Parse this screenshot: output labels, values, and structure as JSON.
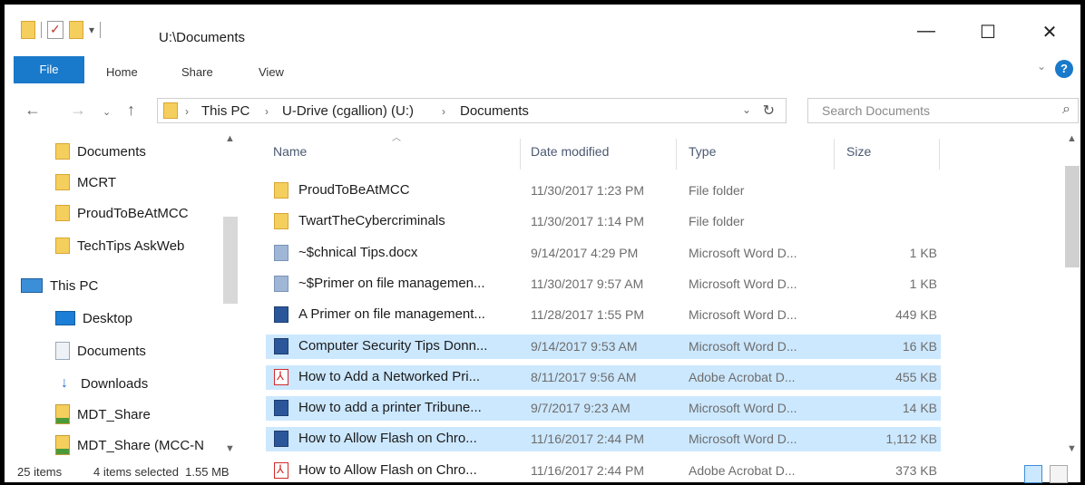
{
  "window": {
    "title": "U:\\Documents"
  },
  "window_controls": {
    "minimize": "—",
    "maximize": "☐",
    "close": "✕"
  },
  "ribbon": {
    "tabs": [
      "File",
      "Home",
      "Share",
      "View"
    ]
  },
  "address": {
    "crumbs": [
      "This PC",
      "U-Drive (cgallion) (U:)",
      "Documents"
    ],
    "search_placeholder": "Search Documents"
  },
  "nav_pane": {
    "items": [
      {
        "label": "Documents",
        "icon": "folder-icon"
      },
      {
        "label": "MCRT",
        "icon": "folder-icon"
      },
      {
        "label": "ProudToBeAtMCC",
        "icon": "folder-icon"
      },
      {
        "label": "TechTips AskWeb",
        "icon": "folder-icon"
      },
      {
        "label": "This PC",
        "icon": "pc-icon"
      },
      {
        "label": "Desktop",
        "icon": "desktop-icon"
      },
      {
        "label": "Documents",
        "icon": "documents-icon"
      },
      {
        "label": "Downloads",
        "icon": "downloads-icon"
      },
      {
        "label": "MDT_Share",
        "icon": "network-share-icon"
      },
      {
        "label": "MDT_Share (MCC-N",
        "icon": "network-share-icon"
      }
    ]
  },
  "columns": {
    "name": "Name",
    "date": "Date modified",
    "type": "Type",
    "size": "Size"
  },
  "files": [
    {
      "name": "ProudToBeAtMCC",
      "date": "11/30/2017 1:23 PM",
      "type": "File folder",
      "size": "",
      "icon": "folder",
      "selected": false
    },
    {
      "name": "TwartTheCybercriminals",
      "date": "11/30/2017 1:14 PM",
      "type": "File folder",
      "size": "",
      "icon": "folder",
      "selected": false
    },
    {
      "name": "~$chnical Tips.docx",
      "date": "9/14/2017 4:29 PM",
      "type": "Microsoft Word D...",
      "size": "1 KB",
      "icon": "wordtemp",
      "selected": false
    },
    {
      "name": "~$Primer on file managemen...",
      "date": "11/30/2017 9:57 AM",
      "type": "Microsoft Word D...",
      "size": "1 KB",
      "icon": "wordtemp",
      "selected": false
    },
    {
      "name": "A Primer on file management...",
      "date": "11/28/2017 1:55 PM",
      "type": "Microsoft Word D...",
      "size": "449 KB",
      "icon": "word",
      "selected": false
    },
    {
      "name": "Computer Security Tips Donn...",
      "date": "9/14/2017 9:53 AM",
      "type": "Microsoft Word D...",
      "size": "16 KB",
      "icon": "word",
      "selected": true
    },
    {
      "name": "How to Add a Networked Pri...",
      "date": "8/11/2017 9:56 AM",
      "type": "Adobe Acrobat D...",
      "size": "455 KB",
      "icon": "pdf",
      "selected": true
    },
    {
      "name": "How to add a printer Tribune...",
      "date": "9/7/2017 9:23 AM",
      "type": "Microsoft Word D...",
      "size": "14 KB",
      "icon": "word",
      "selected": true
    },
    {
      "name": "How to Allow Flash on Chro...",
      "date": "11/16/2017 2:44 PM",
      "type": "Microsoft Word D...",
      "size": "1,112 KB",
      "icon": "word",
      "selected": true
    },
    {
      "name": "How to Allow Flash on Chro...",
      "date": "11/16/2017 2:44 PM",
      "type": "Adobe Acrobat D...",
      "size": "373 KB",
      "icon": "pdf",
      "selected": false
    }
  ],
  "status": {
    "count": "25 items",
    "selection": "4 items selected  1.55 MB"
  },
  "colors": {
    "accent": "#1979ca",
    "selection": "#cce8ff"
  }
}
